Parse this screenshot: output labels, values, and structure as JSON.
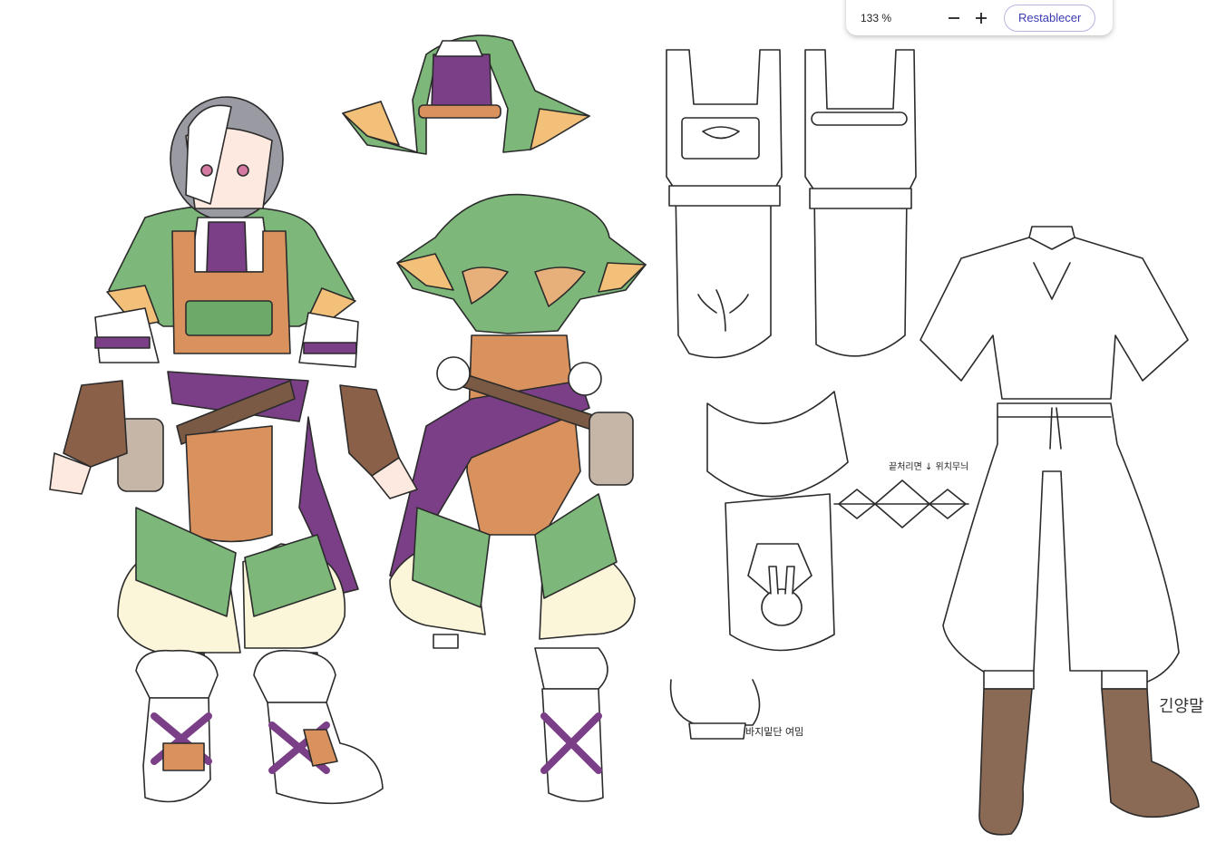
{
  "zoom_toolbar": {
    "zoom_level": "133 %",
    "reset_label": "Restablecer",
    "icons": {
      "zoom_out": "minus-icon",
      "zoom_in": "plus-icon"
    }
  },
  "artwork": {
    "annotations": {
      "pattern_note": "끝처리면 ↓ 위치무늬",
      "pants_note": "바지밑단 여밈",
      "signature": "긴양말"
    },
    "colors": {
      "hood_green": "#7db87a",
      "purple": "#7a3f86",
      "tan_leather": "#d9925e",
      "brown_leather": "#7b5a45",
      "cream": "#fbf5da",
      "hair_grey": "#9a9aa2",
      "boot_brown": "#8a6a55"
    }
  }
}
